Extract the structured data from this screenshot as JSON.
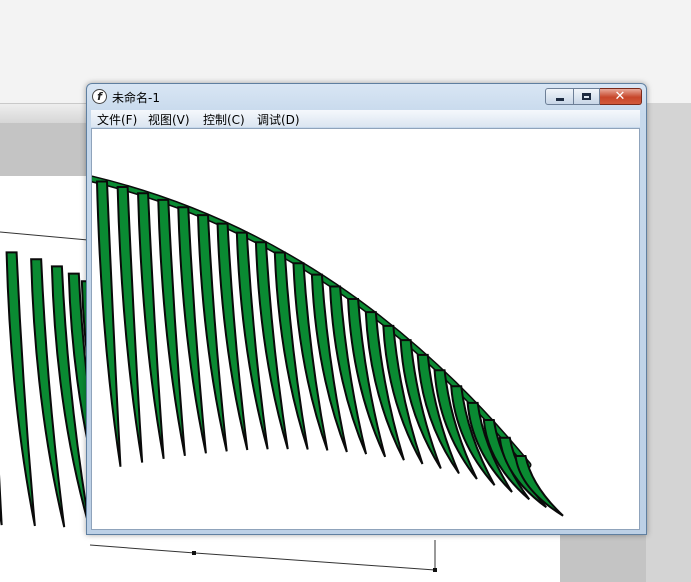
{
  "window": {
    "title": "未命名-1"
  },
  "menu": {
    "items": [
      {
        "label": "文件(F)"
      },
      {
        "label": "视图(V)"
      },
      {
        "label": "控制(C)"
      },
      {
        "label": "调试(D)"
      }
    ]
  },
  "icons": {
    "app": "flash-player-icon",
    "minimize": "minimize-icon",
    "maximize": "maximize-icon",
    "close": "close-icon",
    "grip": "toolbar-grip-icon"
  },
  "colors": {
    "leaf_fill": "#0a8a32",
    "leaf_stroke": "#0a0a0a",
    "close_button": "#c7462b"
  }
}
